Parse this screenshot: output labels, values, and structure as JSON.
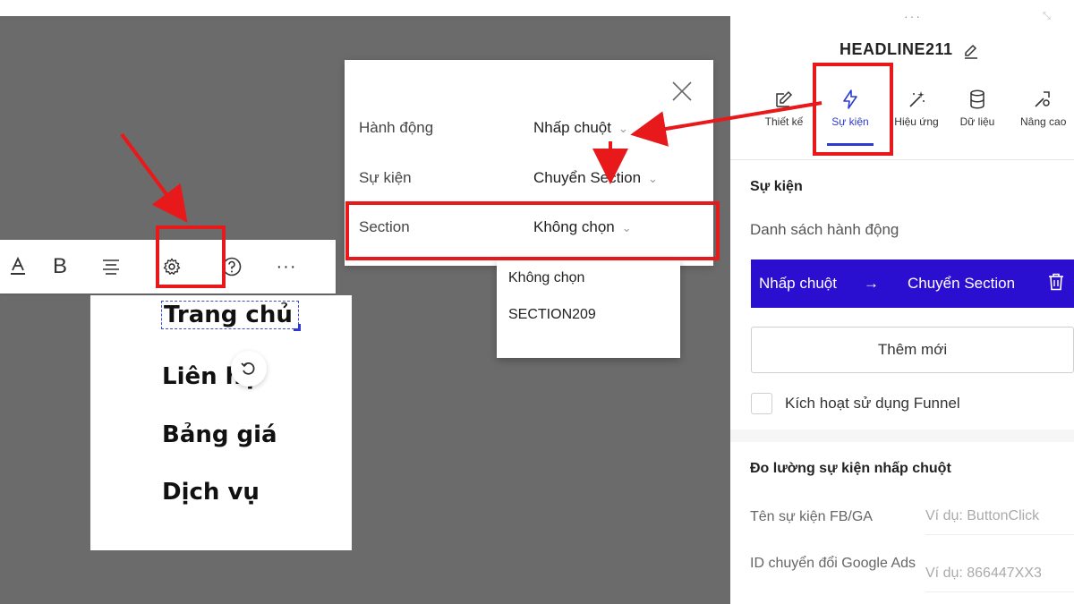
{
  "toolbar": {
    "items": [
      "text-color",
      "bold",
      "align",
      "settings",
      "help",
      "more"
    ],
    "bold_label": "B",
    "more_label": "···"
  },
  "menu": {
    "items": [
      "Trang chủ",
      "Liên hệ",
      "Bảng giá",
      "Dịch vụ"
    ]
  },
  "popup": {
    "rows": [
      {
        "label": "Hành động",
        "value": "Nhấp chuột"
      },
      {
        "label": "Sự kiện",
        "value": "Chuyển Section"
      },
      {
        "label": "Section",
        "value": "Không chọn"
      }
    ],
    "chevron": "⌄",
    "dropdown_options": [
      "Không chọn",
      "SECTION209"
    ]
  },
  "panel": {
    "dots": "···",
    "title": "HEADLINE211",
    "tabs": [
      {
        "label": "Thiết kế",
        "icon": "pencil-square-icon",
        "active": false
      },
      {
        "label": "Sự kiện",
        "icon": "lightning-icon",
        "active": true
      },
      {
        "label": "Hiệu ứng",
        "icon": "magic-wand-icon",
        "active": false
      },
      {
        "label": "Dữ liệu",
        "icon": "database-icon",
        "active": false
      },
      {
        "label": "Nâng cao",
        "icon": "tools-icon",
        "active": false
      }
    ],
    "event_heading": "Sự kiện",
    "action_list_label": "Danh sách hành động",
    "action_bar": {
      "action": "Nhấp chuột",
      "arrow": "→",
      "target": "Chuyển Section"
    },
    "add_button": "Thêm mới",
    "funnel_checkbox": "Kích hoạt sử dụng Funnel",
    "measure_heading": "Đo lường sự kiện nhấp chuột",
    "fields": [
      {
        "label": "Tên sự kiện FB/GA",
        "placeholder": "Ví dụ: ButtonClick"
      },
      {
        "label": "ID chuyển đổi Google Ads",
        "placeholder": "Ví dụ: 866447XX3"
      }
    ]
  },
  "colors": {
    "accent": "#2d3ad1",
    "action_bar": "#2b0fd1",
    "annotation": "#e8191a",
    "canvas": "#6b6b6b"
  }
}
